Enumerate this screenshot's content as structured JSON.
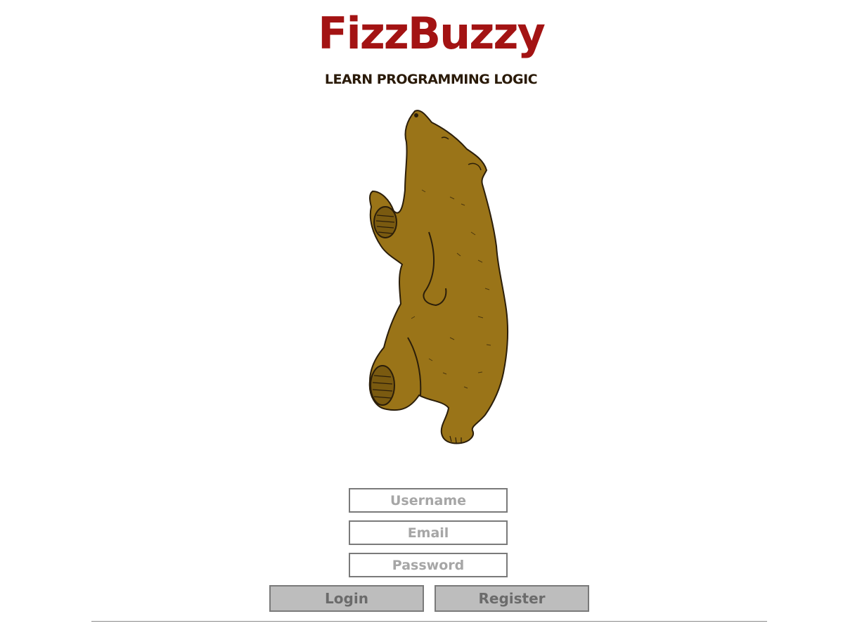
{
  "header": {
    "logo_text": "FizzBuzzy",
    "tagline": "LEARN PROGRAMMING LOGIC"
  },
  "colors": {
    "logo": "#a31313",
    "bear_fur": "#9a7418",
    "button_bg": "#bdbdbd"
  },
  "form": {
    "username_placeholder": "Username",
    "email_placeholder": "Email",
    "password_placeholder": "Password",
    "login_label": "Login",
    "register_label": "Register"
  }
}
